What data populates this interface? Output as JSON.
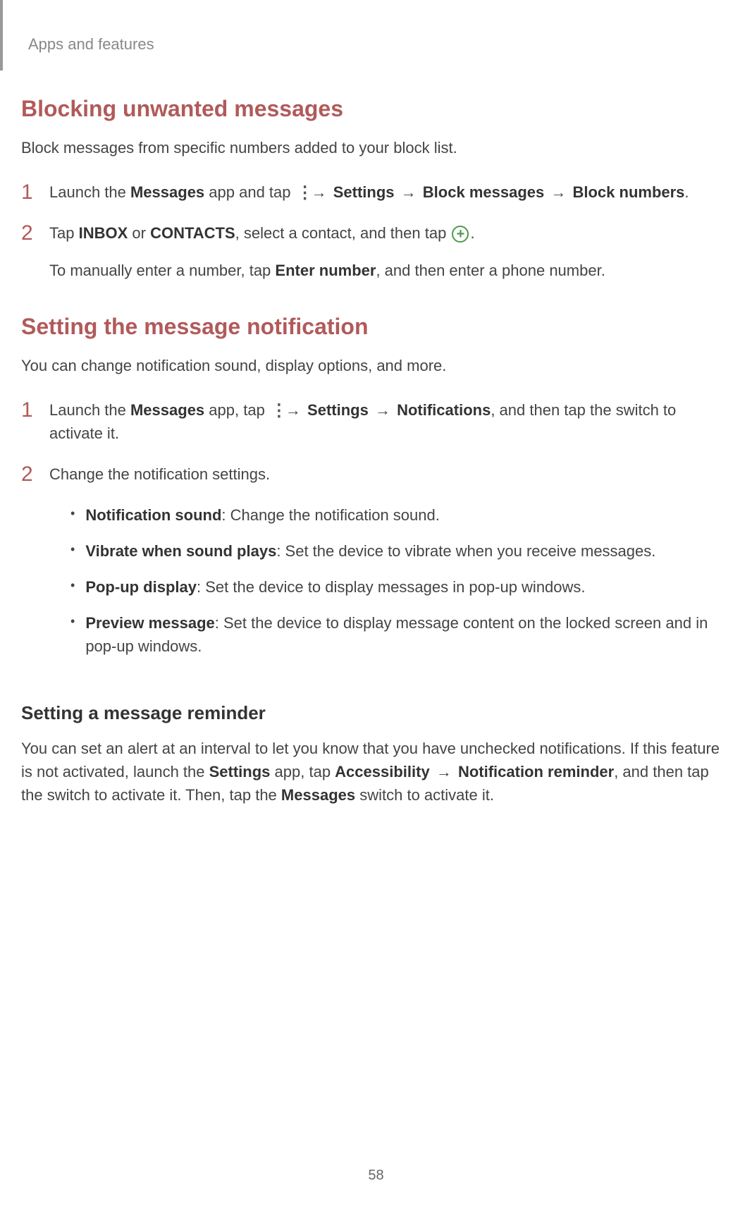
{
  "header": "Apps and features",
  "section1": {
    "heading": "Blocking unwanted messages",
    "intro": "Block messages from specific numbers added to your block list.",
    "steps": [
      {
        "num": "1",
        "prefix": "Launch the ",
        "bold1": "Messages",
        "mid1": " app and tap ",
        "bold2": "Settings",
        "bold3": "Block messages",
        "bold4": "Block numbers",
        "suffix": "."
      },
      {
        "num": "2",
        "prefix": "Tap ",
        "bold1": "INBOX",
        "mid1": " or ",
        "bold2": "CONTACTS",
        "mid2": ", select a contact, and then tap ",
        "suffix": ".",
        "sub_prefix": "To manually enter a number, tap ",
        "sub_bold": "Enter number",
        "sub_suffix": ", and then enter a phone number."
      }
    ]
  },
  "section2": {
    "heading": "Setting the message notification",
    "intro": "You can change notification sound, display options, and more.",
    "steps": [
      {
        "num": "1",
        "prefix": "Launch the ",
        "bold1": "Messages",
        "mid1": " app, tap ",
        "bold2": "Settings",
        "bold3": "Notifications",
        "suffix": ", and then tap the switch to activate it."
      },
      {
        "num": "2",
        "text": "Change the notification settings."
      }
    ],
    "bullets": [
      {
        "bold": "Notification sound",
        "rest": ": Change the notification sound."
      },
      {
        "bold": "Vibrate when sound plays",
        "rest": ": Set the device to vibrate when you receive messages."
      },
      {
        "bold": "Pop-up display",
        "rest": ": Set the device to display messages in pop-up windows."
      },
      {
        "bold": "Preview message",
        "rest": ": Set the device to display message content on the locked screen and in pop-up windows."
      }
    ]
  },
  "section3": {
    "heading": "Setting a message reminder",
    "p1_a": "You can set an alert at an interval to let you know that you have unchecked notifications. If this feature is not activated, launch the ",
    "p1_b1": "Settings",
    "p1_c": " app, tap ",
    "p1_b2": "Accessibility",
    "p1_b3": "Notification reminder",
    "p1_d": ", and then tap the switch to activate it. Then, tap the ",
    "p1_b4": "Messages",
    "p1_e": " switch to activate it."
  },
  "arrow": "→",
  "page_number": "58"
}
